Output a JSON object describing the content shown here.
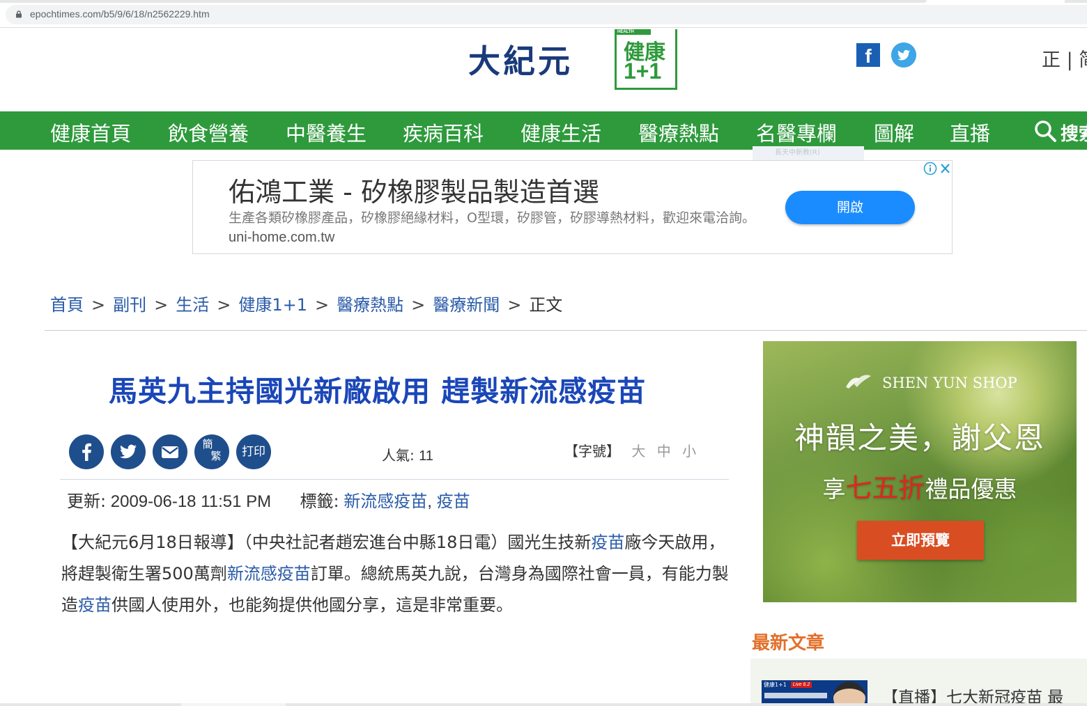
{
  "browser": {
    "url": "epochtimes.com/b5/9/6/18/n2562229.htm"
  },
  "header": {
    "logo_text": "大紀元",
    "health_logo_tag": "HEALTH",
    "health_logo_line1": "健康",
    "health_logo_line2": "1+1",
    "lang_switch": "正 | 简"
  },
  "nav": {
    "items": [
      "健康首頁",
      "飲食營養",
      "中醫養生",
      "疾病百科",
      "健康生活",
      "醫療熱點",
      "名醫專欄",
      "圖解",
      "直播"
    ],
    "search_label": "搜索",
    "under_hint": "長天中新教(R)"
  },
  "ad": {
    "title": "佑鴻工業 - 矽橡膠製品製造首選",
    "description": "生產各類矽橡膠產品，矽橡膠絕緣材料，O型環，矽膠管，矽膠導熱材料，歡迎來電洽詢。",
    "domain": "uni-home.com.tw",
    "button": "開啟"
  },
  "breadcrumb": {
    "items": [
      "首頁",
      "副刊",
      "生活",
      "健康1+1",
      "醫療熱點",
      "醫療新聞"
    ],
    "separator": ">",
    "current": "正文"
  },
  "article": {
    "headline": "馬英九主持國光新廠啟用 趕製新流感疫苗",
    "share": {
      "simplified_label_top": "簡",
      "simplified_label_bottom": "繁",
      "print_label": "打印"
    },
    "views_label": "人氣:",
    "views": "11",
    "font_size_label": "【字號】",
    "font_sizes": [
      "大",
      "中",
      "小"
    ],
    "updated_label": "更新:",
    "updated": "2009-06-18 11:51 PM",
    "tags_label": "標籤:",
    "tags": [
      "新流感疫苗",
      "疫苗"
    ],
    "body": {
      "p1": "【大紀元6月18日報導】（中央社記者趙宏進台中縣18日電）國光生技新",
      "link1": "疫苗",
      "p2": "廠今天啟用，將趕製衛生署500萬劑",
      "link2": "新流感疫苗",
      "p3": "訂單。總統馬英九說，台灣身為國際社會一員，有能力製造",
      "link3": "疫苗",
      "p4": "供國人使用外，也能夠提供他國分享，這是非常重要。"
    }
  },
  "sidebar_ad": {
    "brand": "SHEN YUN SHOP",
    "headline": "神韻之美，謝父恩",
    "subline_prefix": "享",
    "subline_highlight": "七五折",
    "subline_suffix": "禮品優惠",
    "cta": "立即預覽"
  },
  "latest": {
    "heading": "最新文章",
    "thumb_text": "健康1+1",
    "thumb_live": "Live 6.2",
    "first_title": "【直播】七大新冠疫苗 最"
  },
  "colors": {
    "nav_green": "#2e9a3c",
    "headline_blue": "#1a46b8",
    "link_blue": "#2a5ba8",
    "share_navy": "#1f4e8c",
    "accent_orange": "#e2702a",
    "ad_button_blue": "#1a8cff"
  }
}
